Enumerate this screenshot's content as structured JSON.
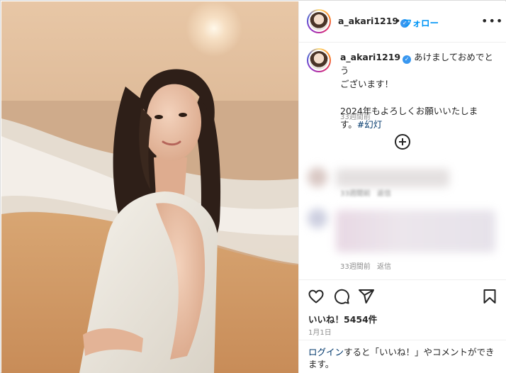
{
  "post": {
    "username": "a_akari1219",
    "follow_label": "フォロー",
    "more_label": "•••",
    "caption_text": "あけましておめでとうございます！\n\n2024年もよろしくお願いいたします。",
    "hashtag": "#幻灯",
    "caption_time": "33週間前"
  },
  "comments": [
    {
      "time": "33週間前",
      "action": "返信"
    },
    {
      "time": "33週間前",
      "action": "返信"
    }
  ],
  "likes_label": "いいね！5454件",
  "date_label": "1月1日",
  "login_prompt": {
    "link": "ログイン",
    "rest": "すると「いいね！」やコメントができます。"
  },
  "icons": {
    "verified": "verified-badge-icon",
    "add_comment": "plus-circle-icon",
    "like": "heart-icon",
    "comment": "comment-bubble-icon",
    "share": "paper-plane-icon",
    "save": "bookmark-icon"
  },
  "colors": {
    "accent_blue": "#0095f6",
    "link_blue": "#00376b",
    "muted": "#8e8e8e"
  }
}
